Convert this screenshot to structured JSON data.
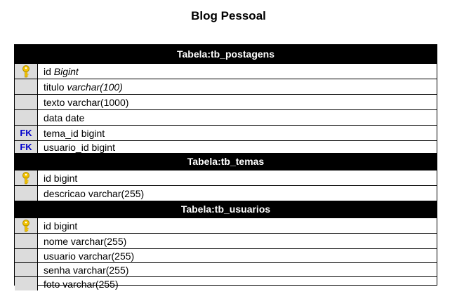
{
  "title": "Blog Pessoal",
  "tables": [
    {
      "header": "Tabela:tb_postagens",
      "fields": [
        {
          "badge": "key",
          "name": "id",
          "type": "Bigint",
          "type_italic": true
        },
        {
          "badge": "",
          "name": "titulo",
          "type": "varchar(100)",
          "type_italic": true
        },
        {
          "badge": "",
          "name": "texto",
          "type": "varchar(1000)",
          "type_italic": false
        },
        {
          "badge": "",
          "name": "data",
          "type": "date",
          "type_italic": false
        },
        {
          "badge": "FK",
          "name": "tema_id",
          "type": "bigint",
          "type_italic": false
        },
        {
          "badge": "FK",
          "name": "usuario_id",
          "type": "bigint",
          "type_italic": false
        }
      ]
    },
    {
      "header": "Tabela:tb_temas",
      "fields": [
        {
          "badge": "key",
          "name": "id",
          "type": "bigint",
          "type_italic": false
        },
        {
          "badge": "",
          "name": "descricao",
          "type": "varchar(255)",
          "type_italic": false
        }
      ]
    },
    {
      "header": "Tabela:tb_usuarios",
      "fields": [
        {
          "badge": "key",
          "name": "id",
          "type": "bigint",
          "type_italic": false
        },
        {
          "badge": "",
          "name": "nome",
          "type": "varchar(255)",
          "type_italic": false
        },
        {
          "badge": "",
          "name": "usuario",
          "type": "varchar(255)",
          "type_italic": false
        },
        {
          "badge": "",
          "name": "senha",
          "type": "varchar(255)",
          "type_italic": false
        },
        {
          "badge": "",
          "name": "foto",
          "type": "varchar(255)",
          "type_italic": false
        }
      ]
    }
  ],
  "colors": {
    "header_bg": "#000000",
    "header_text": "#ffffff",
    "gutter_bg": "#dcdcdc",
    "fk_text": "#0000cc",
    "key_fill": "#f2c200"
  },
  "icons": {
    "primary_key": "key-icon"
  }
}
